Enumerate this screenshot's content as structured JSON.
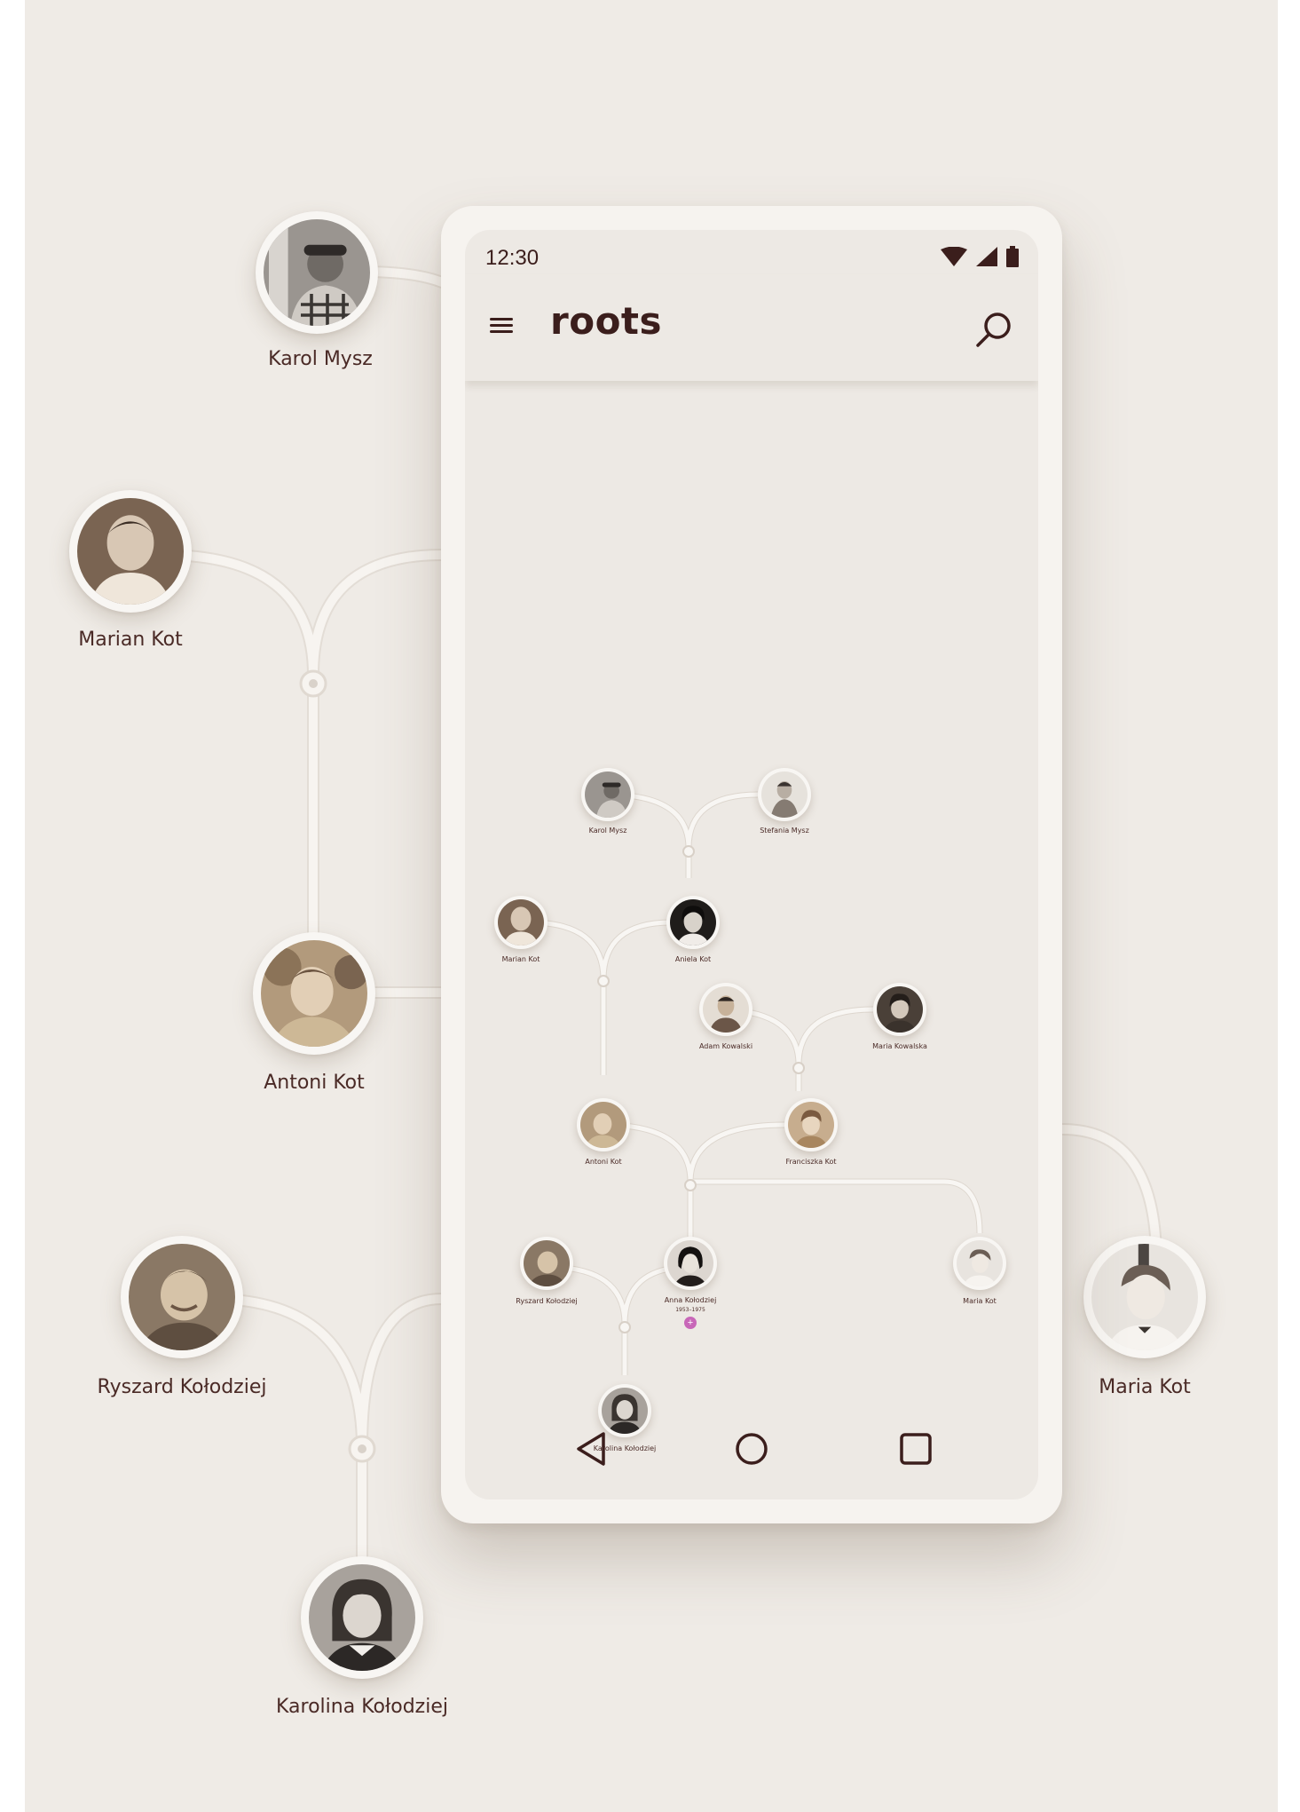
{
  "status_bar": {
    "time": "12:30",
    "icons": [
      "wifi-icon",
      "signal-icon",
      "battery-icon"
    ]
  },
  "app_bar": {
    "title": "roots",
    "menu_icon": "menu-icon",
    "search_icon": "search-icon"
  },
  "background_people": {
    "karol": "Karol Mysz",
    "marian": "Marian Kot",
    "antoni": "Antoni Kot",
    "ryszard": "Ryszard Kołodziej",
    "karolina": "Karolina Kołodziej",
    "maria": "Maria Kot"
  },
  "tree": {
    "karol": "Karol Mysz",
    "stefania": "Stefania Mysz",
    "marian": "Marian Kot",
    "aniela": "Aniela Kot",
    "adam": "Adam Kowalski",
    "maria_k": "Maria Kowalska",
    "antoni": "Antoni Kot",
    "franciszka": "Franciszka Kot",
    "ryszard": "Ryszard Kołodziej",
    "anna": "Anna Kołodziej",
    "anna_years": "1953–1975",
    "maria_kot": "Maria Kot",
    "karolina": "Karolina Kołodziej"
  },
  "nav_bar": {
    "icons": [
      "back-icon",
      "home-icon",
      "recents-icon"
    ]
  },
  "colors": {
    "background": "#efebe6",
    "text": "#4a2a26",
    "accent_add": "#c867b8"
  }
}
